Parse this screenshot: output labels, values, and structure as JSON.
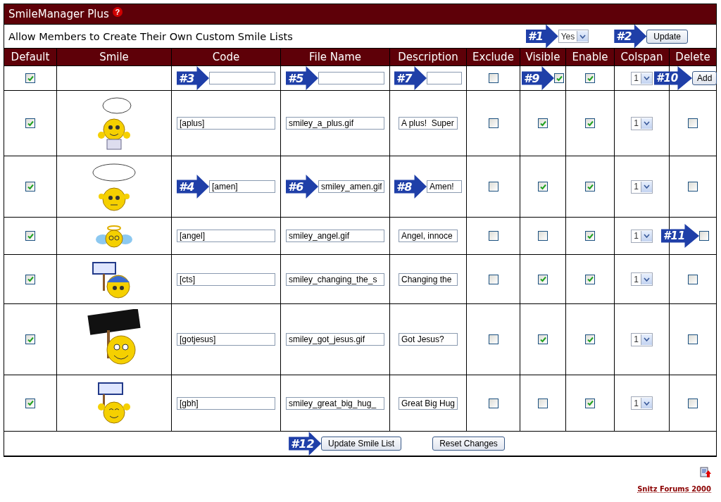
{
  "title": "SmileManager Plus",
  "help": "?",
  "setting": {
    "label": "Allow Members to Create Their Own Custom Smile Lists",
    "value": "Yes",
    "marker": "#1",
    "button": "Update",
    "button_marker": "#2"
  },
  "columns": [
    "Default",
    "Smile",
    "Code",
    "File Name",
    "Description",
    "Exclude",
    "Visible",
    "Enable",
    "Colspan",
    "Delete"
  ],
  "new_row": {
    "default": true,
    "code_marker": "#3",
    "file_marker": "#5",
    "description_marker": "#7",
    "exclude": false,
    "visible": true,
    "visible_marker": "#9",
    "enable": true,
    "colspan": "1",
    "button": "Add",
    "button_marker": "#10"
  },
  "rows": [
    {
      "default": true,
      "code": "[aplus]",
      "file": "smiley_a_plus.gif",
      "description": "A plus!  Super",
      "exclude": false,
      "visible": true,
      "enable": true,
      "colspan": "1",
      "delete": false
    },
    {
      "default": true,
      "code": "[amen]",
      "code_marker": "#4",
      "file": "smiley_amen.gif",
      "file_marker": "#6",
      "description": "Amen!",
      "description_marker": "#8",
      "exclude": false,
      "visible": true,
      "enable": true,
      "colspan": "1",
      "delete": false
    },
    {
      "default": true,
      "code": "[angel]",
      "file": "smiley_angel.gif",
      "description": "Angel, innoce",
      "exclude": false,
      "visible": false,
      "enable": true,
      "colspan": "1",
      "delete": false,
      "delete_marker": "#11"
    },
    {
      "default": true,
      "code": "[cts]",
      "file": "smiley_changing_the_s",
      "description": "Changing the",
      "exclude": false,
      "visible": true,
      "enable": true,
      "colspan": "1",
      "delete": false
    },
    {
      "default": true,
      "code": "[gotjesus]",
      "file": "smiley_got_jesus.gif",
      "description": "Got Jesus?",
      "exclude": false,
      "visible": true,
      "enable": true,
      "colspan": "1",
      "delete": false
    },
    {
      "default": true,
      "code": "[gbh]",
      "file": "smiley_great_big_hug_",
      "description": "Great Big Hug",
      "exclude": false,
      "visible": false,
      "enable": true,
      "colspan": "1",
      "delete": false
    }
  ],
  "footer": {
    "buttons": [
      {
        "label": "Update Smile List",
        "marker": "#12"
      },
      {
        "label": "Reset Changes"
      }
    ]
  },
  "credit": "Snitz Forums 2000"
}
